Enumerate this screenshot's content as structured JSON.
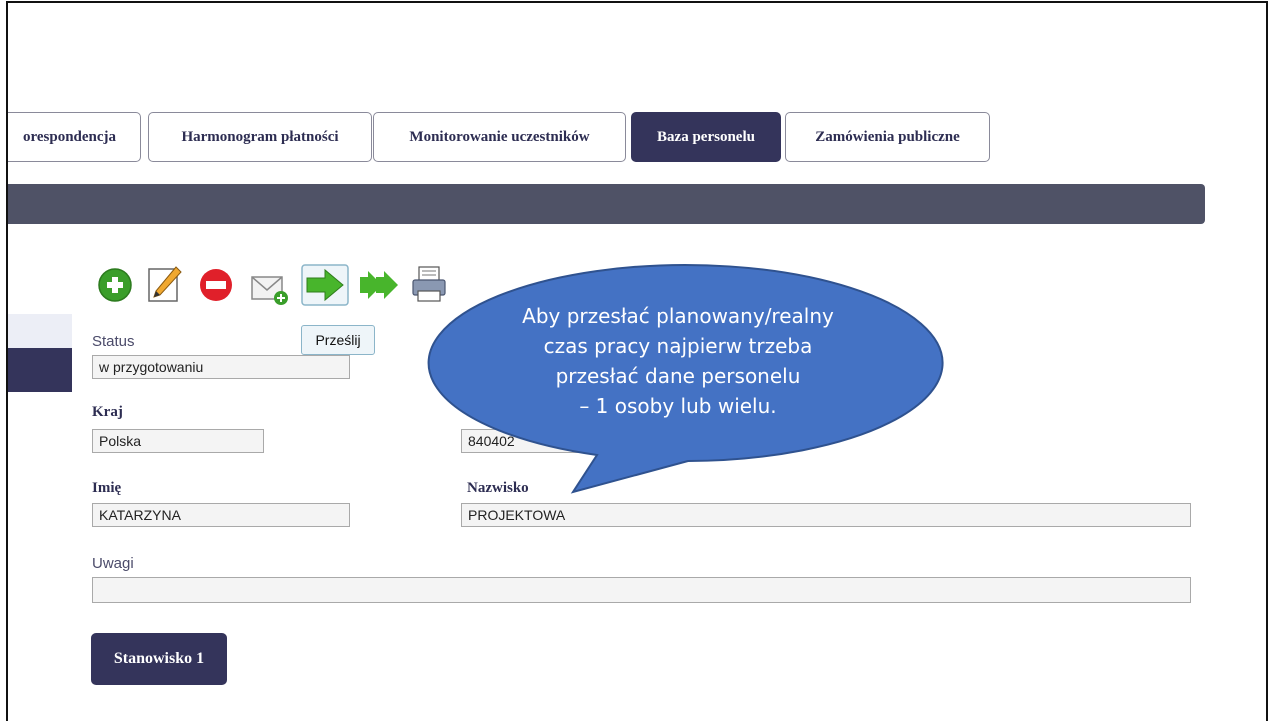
{
  "tabs": [
    {
      "label": "orespondencja",
      "active": false
    },
    {
      "label": "Harmonogram płatności",
      "active": false
    },
    {
      "label": "Monitorowanie uczestników",
      "active": false
    },
    {
      "label": "Baza personelu",
      "active": true
    },
    {
      "label": "Zamówienia publiczne",
      "active": false
    }
  ],
  "toolbar": {
    "icons": [
      "add-icon",
      "edit-icon",
      "delete-icon",
      "send-mail-icon",
      "send-icon",
      "send-all-icon",
      "print-icon"
    ],
    "tooltip": "Prześlij"
  },
  "form": {
    "status_label": "Status",
    "status_value": "w przygotowaniu",
    "kraj_label": "Kraj",
    "kraj_value": "Polska",
    "pesel_value": "840402",
    "imie_label": "Imię",
    "imie_value": "KATARZYNA",
    "nazwisko_label": "Nazwisko",
    "nazwisko_value": "PROJEKTOWA",
    "uwagi_label": "Uwagi",
    "uwagi_value": ""
  },
  "stanowisko_button": "Stanowisko 1",
  "callout": {
    "lines": [
      "Aby przesłać planowany/realny",
      "czas pracy najpierw trzeba",
      "przesłać dane personelu",
      "– 1 osoby lub wielu."
    ]
  },
  "colors": {
    "active_tab": "#34345b",
    "header_bar": "#4f5266",
    "callout_fill": "#4472c4",
    "callout_stroke": "#2f528f"
  }
}
